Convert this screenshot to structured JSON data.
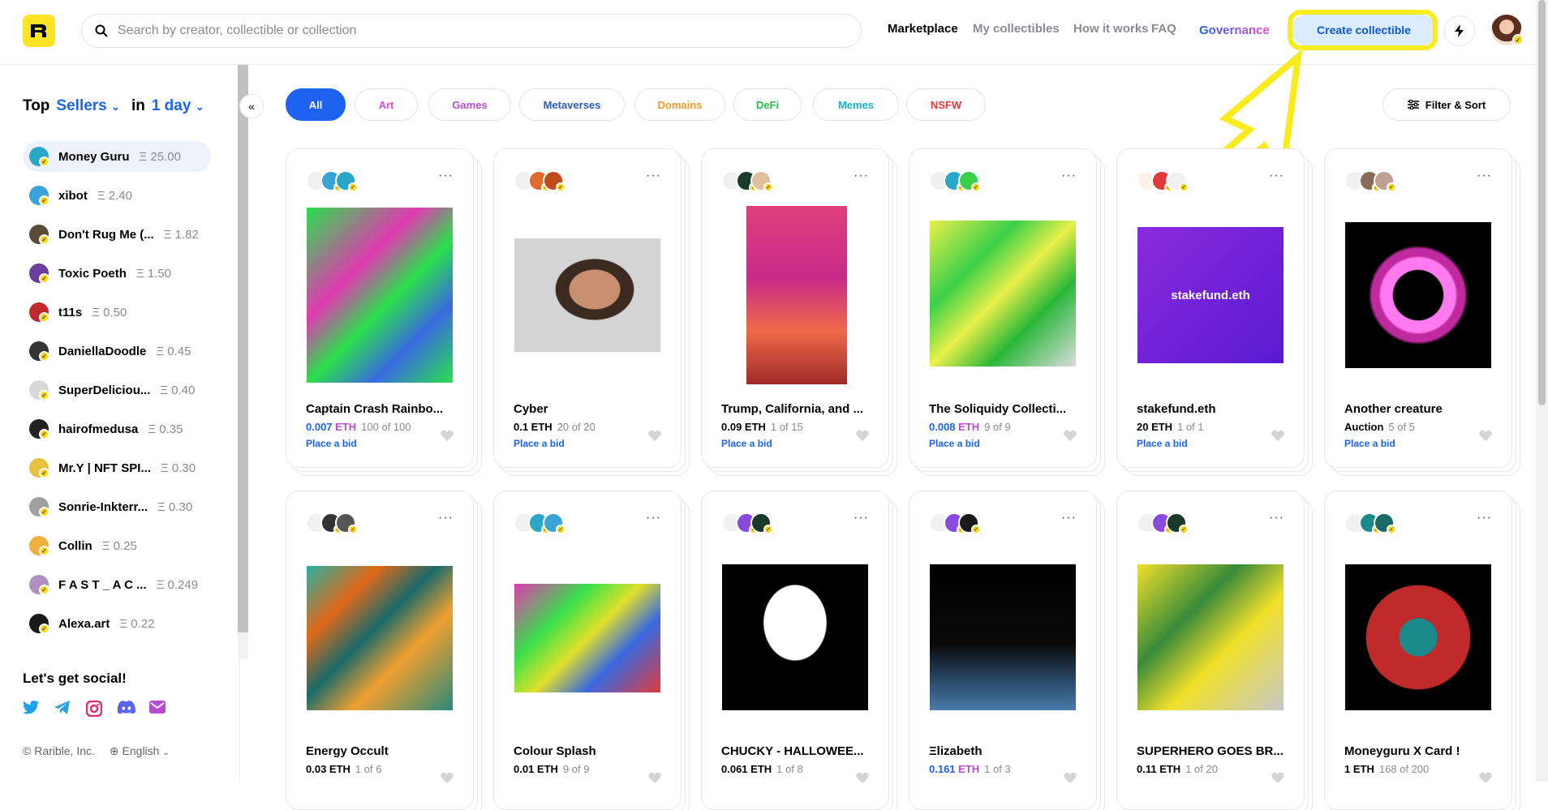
{
  "search": {
    "placeholder": "Search by creator, collectible or collection"
  },
  "nav": {
    "marketplace": "Marketplace",
    "my_collectibles": "My collectibles",
    "how_it_works": "How it works",
    "faq": "FAQ",
    "governance": "Governance"
  },
  "create_button": "Create collectible",
  "sidebar": {
    "top": "Top",
    "sellers": "Sellers",
    "in": "in",
    "period": "1 day",
    "sellers_list": [
      {
        "name": "Money Guru",
        "amount": "Ξ 25.00",
        "color": "#2aa6c8"
      },
      {
        "name": "xibot",
        "amount": "Ξ 2.40",
        "color": "#39a3d8"
      },
      {
        "name": "Don't Rug Me (...",
        "amount": "Ξ 1.82",
        "color": "#5a4a3a"
      },
      {
        "name": "Toxic Poeth",
        "amount": "Ξ 1.50",
        "color": "#6a3d9a"
      },
      {
        "name": "t11s",
        "amount": "Ξ 0.50",
        "color": "#c02a2a"
      },
      {
        "name": "DaniellaDoodle",
        "amount": "Ξ 0.45",
        "color": "#333333"
      },
      {
        "name": "SuperDeliciou...",
        "amount": "Ξ 0.40",
        "color": "#d8d8d8"
      },
      {
        "name": "hairofmedusa",
        "amount": "Ξ 0.35",
        "color": "#222222"
      },
      {
        "name": "Mr.Y | NFT SPI...",
        "amount": "Ξ 0.30",
        "color": "#e8c040"
      },
      {
        "name": "Sonrie-Inkterr...",
        "amount": "Ξ 0.30",
        "color": "#a0a0a0"
      },
      {
        "name": "Collin",
        "amount": "Ξ 0.25",
        "color": "#f0b040"
      },
      {
        "name": "F A S T _ A C ...",
        "amount": "Ξ 0.249",
        "color": "#b090c0"
      },
      {
        "name": "Alexa.art",
        "amount": "Ξ 0.22",
        "color": "#1a1a1a"
      }
    ],
    "social_title": "Let's get social!",
    "copyright": "© Rarible, Inc.",
    "language": "English"
  },
  "filters": [
    {
      "label": "All",
      "color": "#ffffff"
    },
    {
      "label": "Art",
      "color": "#e64ccf"
    },
    {
      "label": "Games",
      "color": "#b84ccf"
    },
    {
      "label": "Metaverses",
      "color": "#2a5ab8"
    },
    {
      "label": "Domains",
      "color": "#f09a2a"
    },
    {
      "label": "DeFi",
      "color": "#2ab84c"
    },
    {
      "label": "Memes",
      "color": "#1ab0c8"
    },
    {
      "label": "NSFW",
      "color": "#e63a3a"
    }
  ],
  "filter_sort": "Filter & Sort",
  "cards": [
    {
      "title": "Captain Crash Rainbo...",
      "price": "0.007",
      "unit": "ETH",
      "count": "100 of 100",
      "bid": "Place a bid",
      "gradient_price": true
    },
    {
      "title": "Cyber",
      "price": "0.1 ETH",
      "unit": "",
      "count": "20 of 20",
      "bid": "Place a bid",
      "gradient_price": false
    },
    {
      "title": "Trump, California, and ...",
      "price": "0.09 ETH",
      "unit": "",
      "count": "1 of 15",
      "bid": "Place a bid",
      "gradient_price": false
    },
    {
      "title": "The Soliquidy Collecti...",
      "price": "0.008",
      "unit": "ETH",
      "count": "9 of 9",
      "bid": "Place a bid",
      "gradient_price": true
    },
    {
      "title": "stakefund.eth",
      "price": "20 ETH",
      "unit": "",
      "count": "1 of 1",
      "bid": "Place a bid",
      "gradient_price": false,
      "art_text": "stakefund.eth"
    },
    {
      "title": "Another creature",
      "price": "Auction",
      "unit": "",
      "count": "5 of 5",
      "bid": "Place a bid",
      "gradient_price": false
    },
    {
      "title": "Energy Occult",
      "price": "0.03 ETH",
      "unit": "",
      "count": "1 of 6",
      "bid": "",
      "gradient_price": false
    },
    {
      "title": "Colour Splash",
      "price": "0.01 ETH",
      "unit": "",
      "count": "9 of 9",
      "bid": "",
      "gradient_price": false
    },
    {
      "title": "CHUCKY - HALLOWEE...",
      "price": "0.061 ETH",
      "unit": "",
      "count": "1 of 8",
      "bid": "",
      "gradient_price": false
    },
    {
      "title": "Ξlizabeth",
      "price": "0.161",
      "unit": "ETH",
      "count": "1 of 3",
      "bid": "",
      "gradient_price": true
    },
    {
      "title": "SUPERHERO GOES BR...",
      "price": "0.11 ETH",
      "unit": "",
      "count": "1 of 20",
      "bid": "",
      "gradient_price": false
    },
    {
      "title": "Moneyguru X Card !",
      "price": "1 ETH",
      "unit": "",
      "count": "168 of 200",
      "bid": "",
      "gradient_price": false
    }
  ]
}
